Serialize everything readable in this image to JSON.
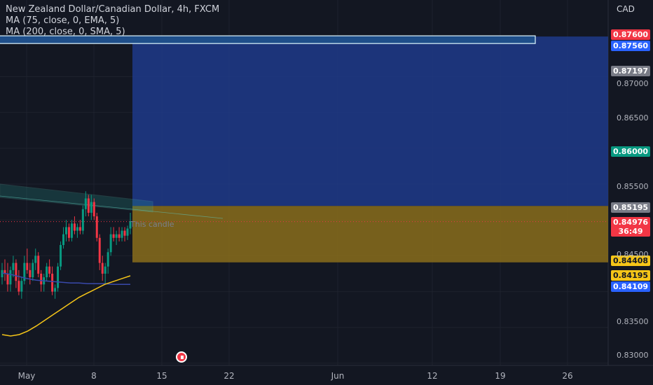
{
  "legend": {
    "symbol": "New Zealand Dollar/Canadian Dollar, 4h, FXCM",
    "ma1": "MA (75, close, 0, EMA, 5)",
    "ma2": "MA (200, close, 0, SMA, 5)"
  },
  "currency": "CAD",
  "price_labels": {
    "p1": {
      "text": "0.87600",
      "color": "#f23645"
    },
    "p2": {
      "text": "0.87560",
      "color": "#2962ff"
    },
    "p3": {
      "text": "0.87197",
      "color": "#787b86"
    },
    "p4": {
      "text": "0.86000",
      "color": "#089981"
    },
    "p5": {
      "text": "0.85195",
      "color": "#787b86"
    },
    "p6": {
      "text": "0.84976",
      "color": "#f23645"
    },
    "p6b": {
      "text": "36:49",
      "color": "#f23645"
    },
    "p7": {
      "text": "0.84408",
      "color": "#f5c518"
    },
    "p8": {
      "text": "0.84195",
      "color": "#f5c518"
    },
    "p9": {
      "text": "0.84109",
      "color": "#2962ff"
    }
  },
  "candle_label": "This candle",
  "icons": {
    "alert": "alert-icon"
  },
  "chart_data": {
    "type": "candlestick",
    "title": "New Zealand Dollar/Canadian Dollar, 4h, FXCM",
    "yaxis_ticks": [
      "0.87000",
      "0.86500",
      "0.85500",
      "0.84500",
      "0.83500",
      "0.83000"
    ],
    "xaxis_ticks": [
      "May",
      "8",
      "15",
      "22",
      "Jun",
      "12",
      "19",
      "26"
    ],
    "ylim": [
      0.8297,
      0.8805
    ],
    "zones": {
      "target": {
        "top": 0.8756,
        "bottom": 0.85195,
        "color": "#1e3a8a"
      },
      "stop": {
        "top": 0.85195,
        "bottom": 0.84408,
        "color": "#8a6d1b"
      }
    },
    "current_price": 0.84976,
    "ohlc": [
      [
        0.842,
        0.844,
        0.841,
        0.843
      ],
      [
        0.843,
        0.8445,
        0.8415,
        0.8425
      ],
      [
        0.8425,
        0.844,
        0.84,
        0.841
      ],
      [
        0.841,
        0.8435,
        0.84,
        0.843
      ],
      [
        0.843,
        0.845,
        0.842,
        0.844
      ],
      [
        0.844,
        0.8445,
        0.8405,
        0.8415
      ],
      [
        0.8415,
        0.843,
        0.8395,
        0.84
      ],
      [
        0.84,
        0.842,
        0.839,
        0.8415
      ],
      [
        0.8415,
        0.845,
        0.841,
        0.844
      ],
      [
        0.844,
        0.846,
        0.8425,
        0.843
      ],
      [
        0.843,
        0.844,
        0.841,
        0.842
      ],
      [
        0.842,
        0.8445,
        0.8415,
        0.844
      ],
      [
        0.844,
        0.846,
        0.843,
        0.845
      ],
      [
        0.845,
        0.8455,
        0.842,
        0.8425
      ],
      [
        0.8425,
        0.843,
        0.84,
        0.841
      ],
      [
        0.841,
        0.8425,
        0.84,
        0.842
      ],
      [
        0.842,
        0.844,
        0.8415,
        0.8435
      ],
      [
        0.8435,
        0.8445,
        0.842,
        0.8425
      ],
      [
        0.8425,
        0.8435,
        0.8395,
        0.84
      ],
      [
        0.84,
        0.841,
        0.839,
        0.8405
      ],
      [
        0.8405,
        0.844,
        0.84,
        0.8435
      ],
      [
        0.8435,
        0.847,
        0.843,
        0.8465
      ],
      [
        0.8465,
        0.849,
        0.846,
        0.848
      ],
      [
        0.848,
        0.85,
        0.847,
        0.849
      ],
      [
        0.849,
        0.8495,
        0.847,
        0.8475
      ],
      [
        0.8475,
        0.85,
        0.847,
        0.8495
      ],
      [
        0.8495,
        0.8505,
        0.848,
        0.8485
      ],
      [
        0.8485,
        0.8495,
        0.8475,
        0.849
      ],
      [
        0.849,
        0.85,
        0.848,
        0.8485
      ],
      [
        0.8485,
        0.852,
        0.848,
        0.8515
      ],
      [
        0.8515,
        0.854,
        0.8505,
        0.853
      ],
      [
        0.853,
        0.8535,
        0.8505,
        0.851
      ],
      [
        0.851,
        0.8535,
        0.85,
        0.8525
      ],
      [
        0.8525,
        0.853,
        0.85,
        0.8505
      ],
      [
        0.8505,
        0.851,
        0.847,
        0.8475
      ],
      [
        0.8475,
        0.848,
        0.843,
        0.844
      ],
      [
        0.844,
        0.845,
        0.8415,
        0.8425
      ],
      [
        0.8425,
        0.844,
        0.841,
        0.8435
      ],
      [
        0.8435,
        0.846,
        0.8425,
        0.8455
      ],
      [
        0.8455,
        0.849,
        0.845,
        0.848
      ],
      [
        0.848,
        0.849,
        0.847,
        0.8475
      ],
      [
        0.8475,
        0.8485,
        0.8465,
        0.848
      ],
      [
        0.848,
        0.849,
        0.847,
        0.8475
      ],
      [
        0.8475,
        0.849,
        0.847,
        0.8485
      ],
      [
        0.8485,
        0.849,
        0.847,
        0.8478
      ],
      [
        0.8478,
        0.8492,
        0.8472,
        0.8488
      ],
      [
        0.8488,
        0.851,
        0.848,
        0.8498
      ]
    ],
    "ma75": [
      0.834,
      0.8338,
      0.834,
      0.8345,
      0.8352,
      0.836,
      0.8368,
      0.8376,
      0.8384,
      0.8392,
      0.8398,
      0.8404,
      0.841,
      0.8414,
      0.8418,
      0.8422
    ],
    "ma200": [
      0.8426,
      0.8424,
      0.8421,
      0.8418,
      0.8416,
      0.8415,
      0.8414,
      0.8413,
      0.8412,
      0.8412,
      0.8411,
      0.8411,
      0.8411,
      0.841,
      0.841,
      0.841
    ]
  }
}
